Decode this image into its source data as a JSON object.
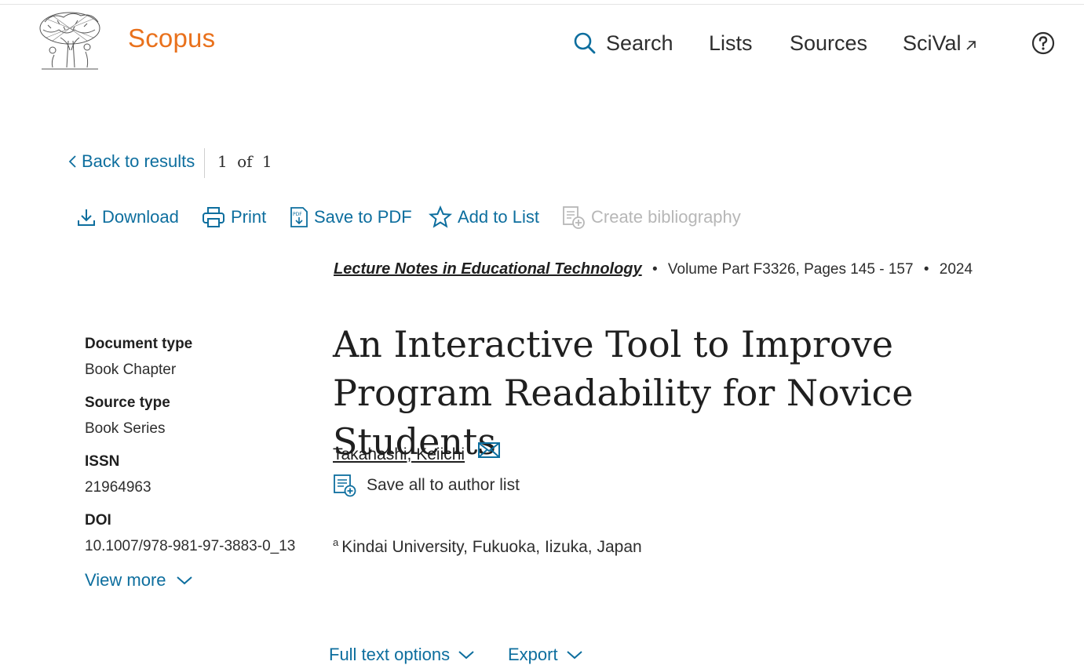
{
  "header": {
    "brand": "Scopus",
    "nav": {
      "search": "Search",
      "lists": "Lists",
      "sources": "Sources",
      "scival": "SciVal"
    },
    "help_icon": "question-circle-icon"
  },
  "navigation": {
    "back": "Back to results",
    "page_current": "1",
    "page_of": "of",
    "page_total": "1"
  },
  "actions": {
    "download": "Download",
    "print": "Print",
    "save_pdf": "Save to PDF",
    "add_list": "Add to List",
    "create_bib": "Create bibliography"
  },
  "source": {
    "journal": "Lecture Notes in Educational Technology",
    "details": "Volume Part F3326, Pages 145 - 157",
    "year": "2024"
  },
  "document": {
    "title": "An Interactive Tool to Improve Program Readability for Novice Students",
    "author": "Takahashi, Keiichi",
    "save_author": "Save all to author list",
    "affiliation_marker": "a",
    "affiliation": "Kindai University, Fukuoka, Iizuka, Japan"
  },
  "metadata": {
    "doc_type_label": "Document type",
    "doc_type": "Book Chapter",
    "source_type_label": "Source type",
    "source_type": "Book Series",
    "issn_label": "ISSN",
    "issn": "21964963",
    "doi_label": "DOI",
    "doi": "10.1007/978-981-97-3883-0_13",
    "view_more": "View more"
  },
  "bottom": {
    "full_text": "Full text options",
    "export": "Export"
  },
  "colors": {
    "brand": "#e9711c",
    "link": "#0d6e9e",
    "disabled": "#b7b7b7"
  }
}
